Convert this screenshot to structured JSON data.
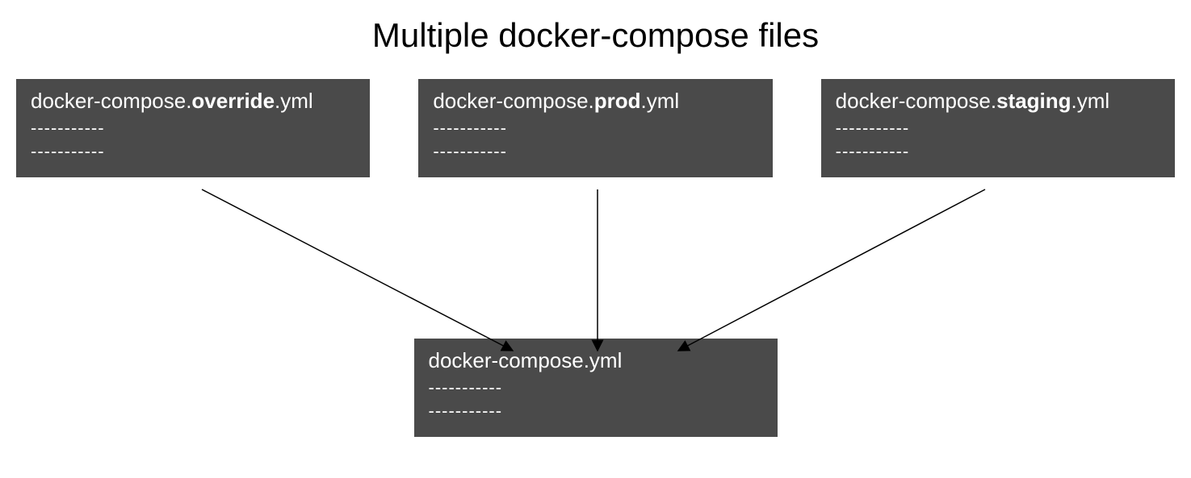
{
  "title": "Multiple docker-compose files",
  "topFiles": [
    {
      "prefix": "docker-compose.",
      "bold": "override",
      "suffix": ".yml",
      "dashes1": "-----------",
      "dashes2": "-----------"
    },
    {
      "prefix": "docker-compose.",
      "bold": "prod",
      "suffix": ".yml",
      "dashes1": "-----------",
      "dashes2": "-----------"
    },
    {
      "prefix": "docker-compose.",
      "bold": "staging",
      "suffix": ".yml",
      "dashes1": "-----------",
      "dashes2": "-----------"
    }
  ],
  "bottomFile": {
    "filename": "docker-compose.yml",
    "dashes1": "-----------",
    "dashes2": "-----------"
  }
}
